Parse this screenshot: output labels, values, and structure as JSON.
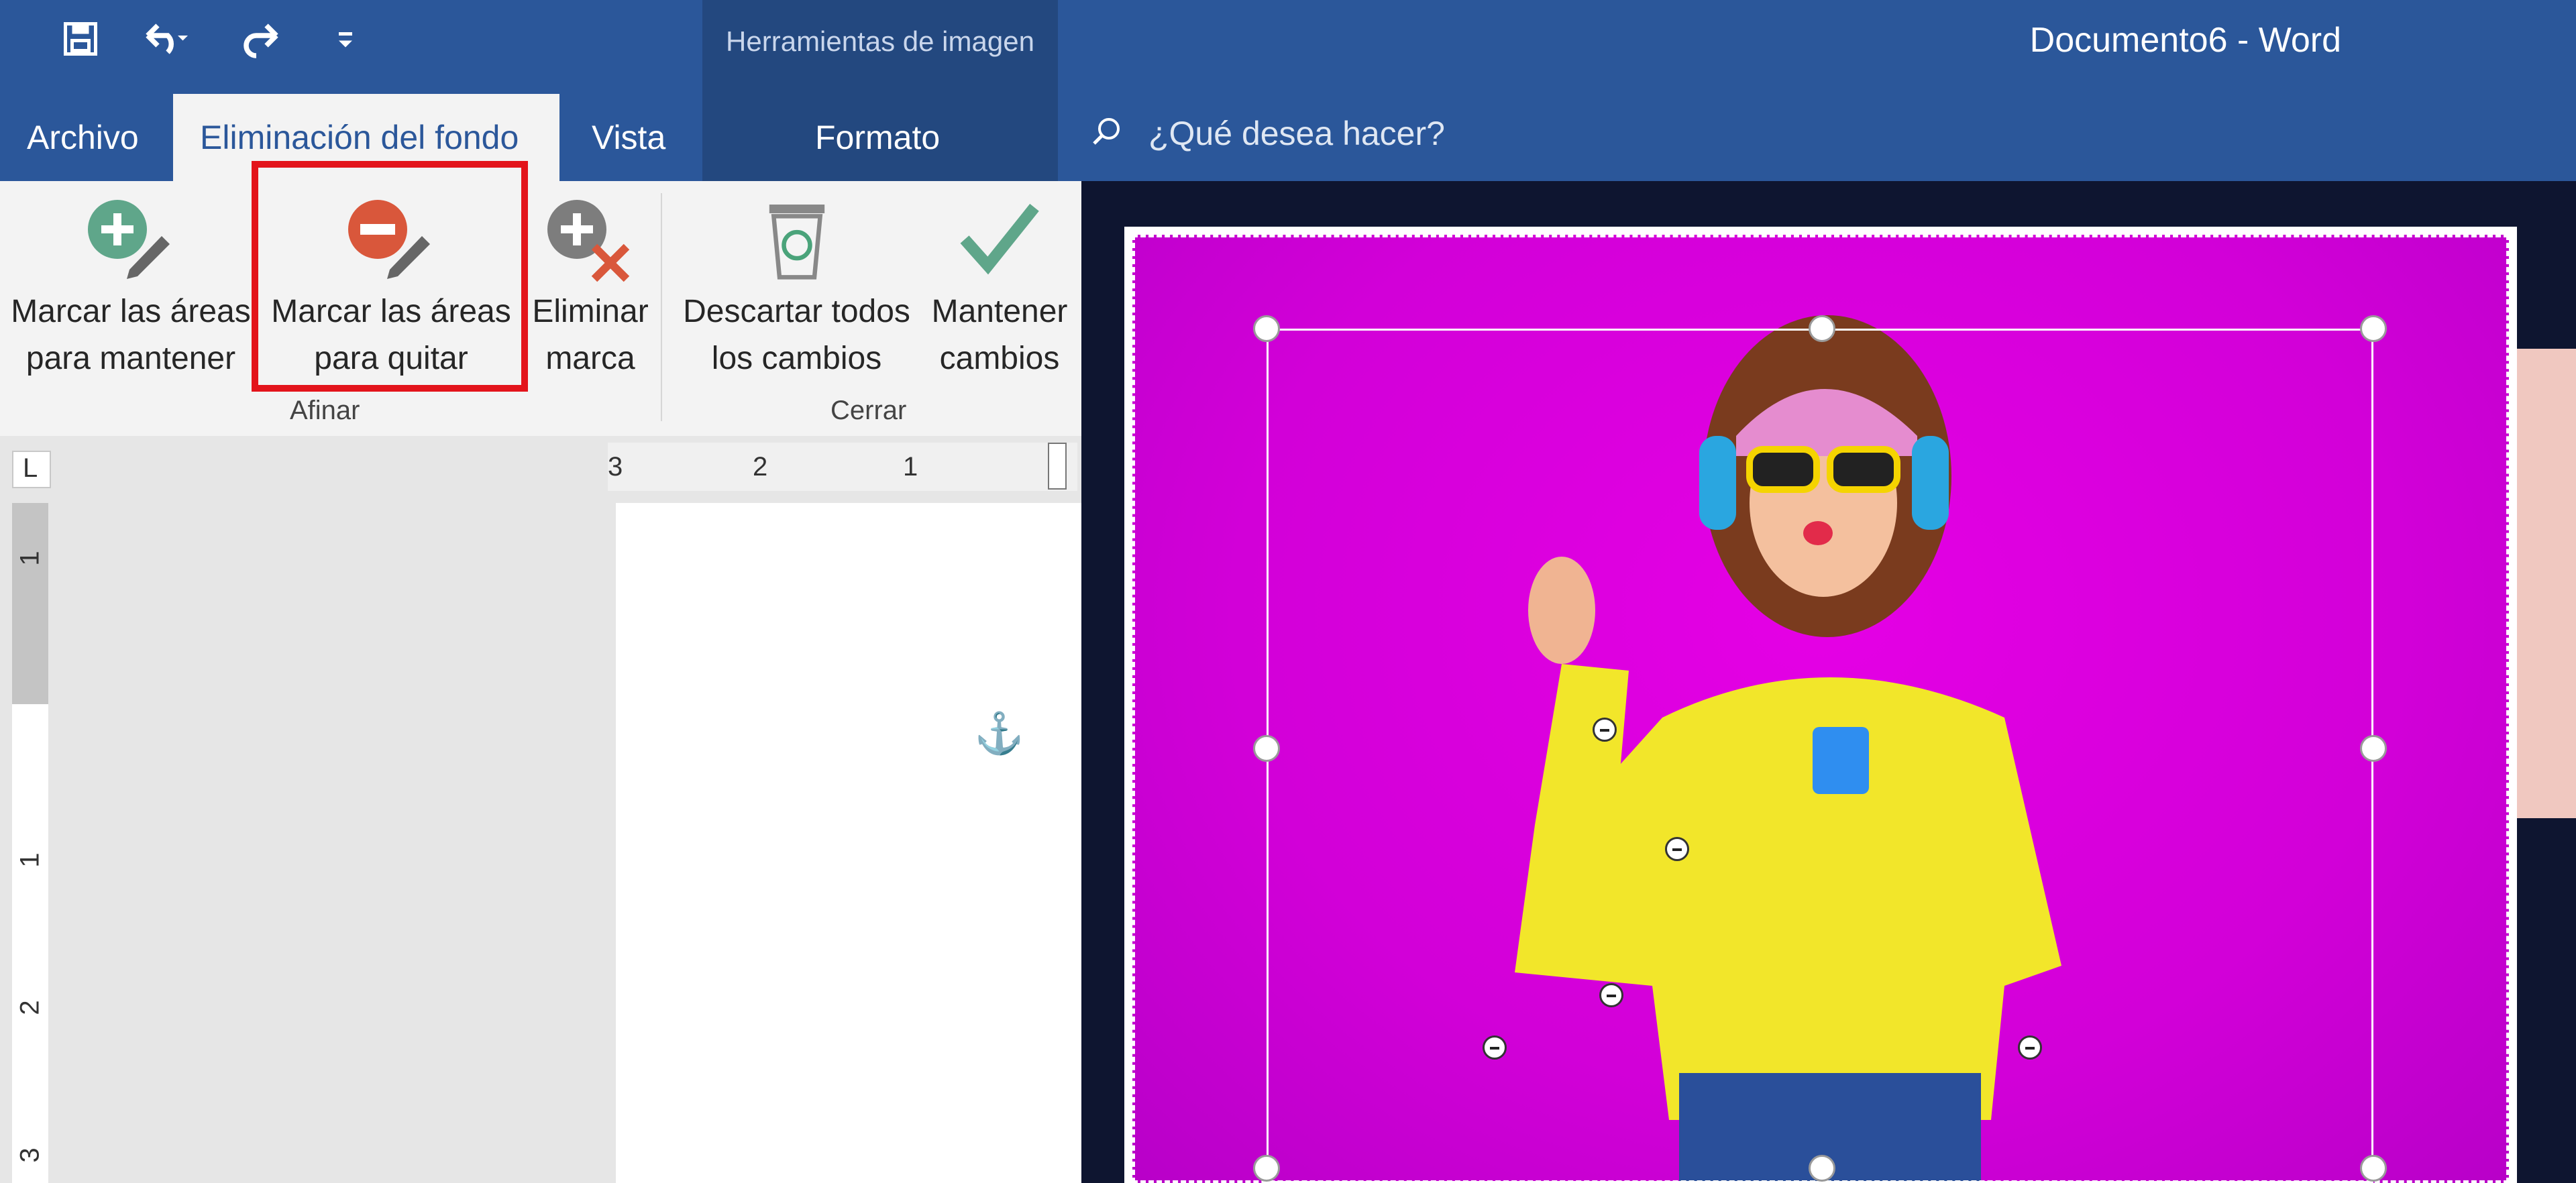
{
  "title_bar": {
    "context_group": "Herramientas de imagen",
    "document_title": "Documento6  -  Word"
  },
  "qat": {
    "save_icon": "save-icon",
    "undo_icon": "undo-icon",
    "redo_icon": "redo-icon",
    "customize_icon": "qat-dropdown-icon"
  },
  "tabs": {
    "archivo": "Archivo",
    "eliminacion": "Eliminación del fondo",
    "vista": "Vista",
    "formato": "Formato"
  },
  "search": {
    "placeholder": "¿Qué desea hacer?"
  },
  "ribbon": {
    "mark_keep": {
      "line1": "Marcar las áreas",
      "line2": "para mantener"
    },
    "mark_remove": {
      "line1": "Marcar las áreas",
      "line2": "para quitar"
    },
    "delete_mark": {
      "line1": "Eliminar",
      "line2": "marca"
    },
    "discard": {
      "line1": "Descartar todos",
      "line2": "los cambios"
    },
    "keep": {
      "line1": "Mantener",
      "line2": "cambios"
    },
    "group_refine": "Afinar",
    "group_close": "Cerrar"
  },
  "ruler": {
    "h_labels": [
      "3",
      "2",
      "1"
    ],
    "v_labels": [
      "1",
      "1",
      "2",
      "3"
    ],
    "corner_symbol": "L"
  },
  "colors": {
    "ribbon_blue": "#2b579a",
    "highlight": "#e3141b",
    "photo_bg": "#e000e0"
  }
}
